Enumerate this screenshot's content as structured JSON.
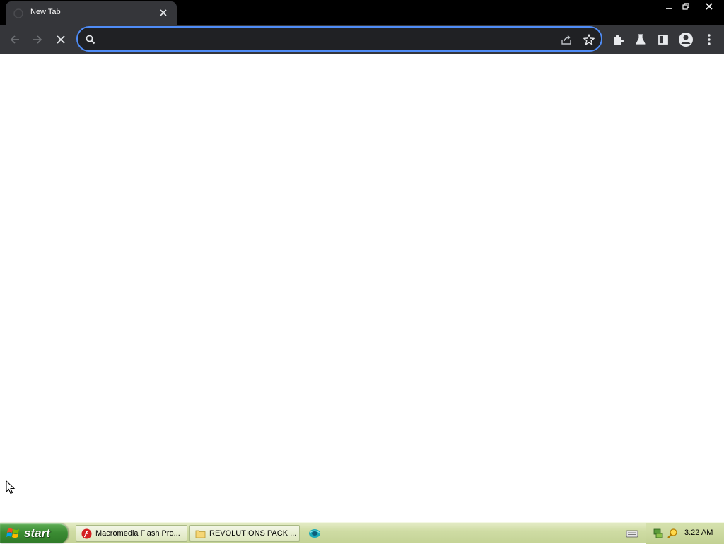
{
  "tab": {
    "title": "New Tab"
  },
  "omnibox": {
    "value": "",
    "placeholder": ""
  },
  "taskbar": {
    "start_label": "start",
    "tasks": [
      {
        "label": "Macromedia Flash Pro...",
        "icon": "flash-icon"
      },
      {
        "label": "REVOLUTIONS PACK ...",
        "icon": "folder-icon"
      }
    ],
    "clock": "3:22 AM"
  },
  "colors": {
    "chrome_frame": "#000000",
    "chrome_toolbar": "#35363a",
    "omnibox_bg": "#202124",
    "omnibox_focus": "#4f8cf6",
    "taskbar_bg": "#cfdca4",
    "start_button": "#3b8c33"
  }
}
